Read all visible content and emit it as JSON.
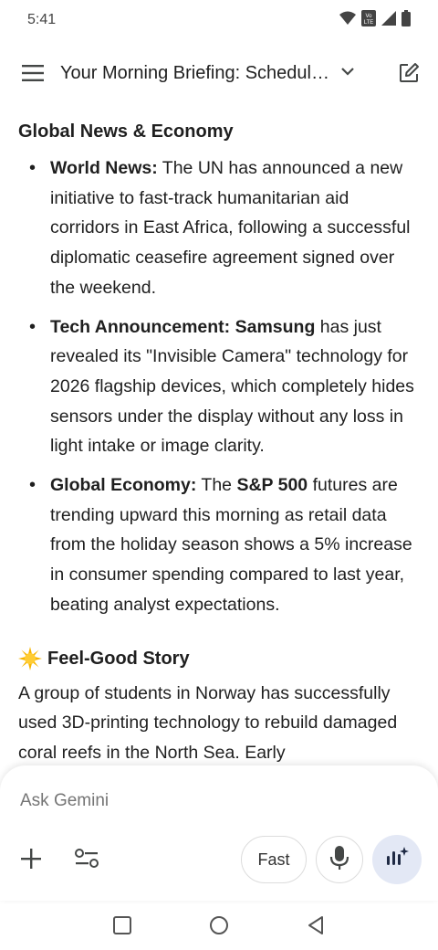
{
  "status_bar": {
    "time": "5:41",
    "icons": [
      "wifi-icon",
      "volte-icon",
      "signal-icon",
      "battery-icon"
    ]
  },
  "top_bar": {
    "menu_icon": "menu-icon",
    "title": "Your Morning Briefing: Schedul…",
    "chevron_icon": "chevron-down-icon",
    "edit_icon": "edit-icon"
  },
  "content": {
    "section_heading": "Global News & Economy",
    "bullets": [
      {
        "bold": "World News:",
        "text": " The UN has announced a new initiative to fast-track humanitarian aid corridors in East Africa, following a successful diplomatic ceasefire agreement signed over the weekend."
      },
      {
        "bold": "Tech Announcement: Samsung",
        "text": " has just revealed its \"Invisible Camera\" technology for 2026 flagship devices, which completely hides sensors under the display without any loss in light intake or image clarity."
      },
      {
        "bold": "Global Economy:",
        "text_before": " The ",
        "bold2": "S&P 500",
        "text_after": " futures are trending upward this morning as retail data from the holiday season shows a 5% increase in consumer spending compared to last year, beating analyst expectations."
      }
    ],
    "feel_good": {
      "emoji_icon": "sun-icon",
      "heading": "Feel-Good Story",
      "paragraph": "A group of students in Norway has successfully used 3D-printing technology to rebuild damaged coral reefs in the North Sea. Early"
    }
  },
  "composer": {
    "placeholder": "Ask Gemini",
    "value": "",
    "fast_label": "Fast",
    "icons": [
      "plus-icon",
      "tools-icon",
      "mic-icon",
      "live-icon"
    ]
  },
  "nav": {
    "icons": [
      "recents-icon",
      "home-icon",
      "back-icon"
    ]
  },
  "colors": {
    "background": "#ffffff",
    "text": "#1f1f1f",
    "live_button": "#e3e8f5",
    "icon": "#444746"
  }
}
